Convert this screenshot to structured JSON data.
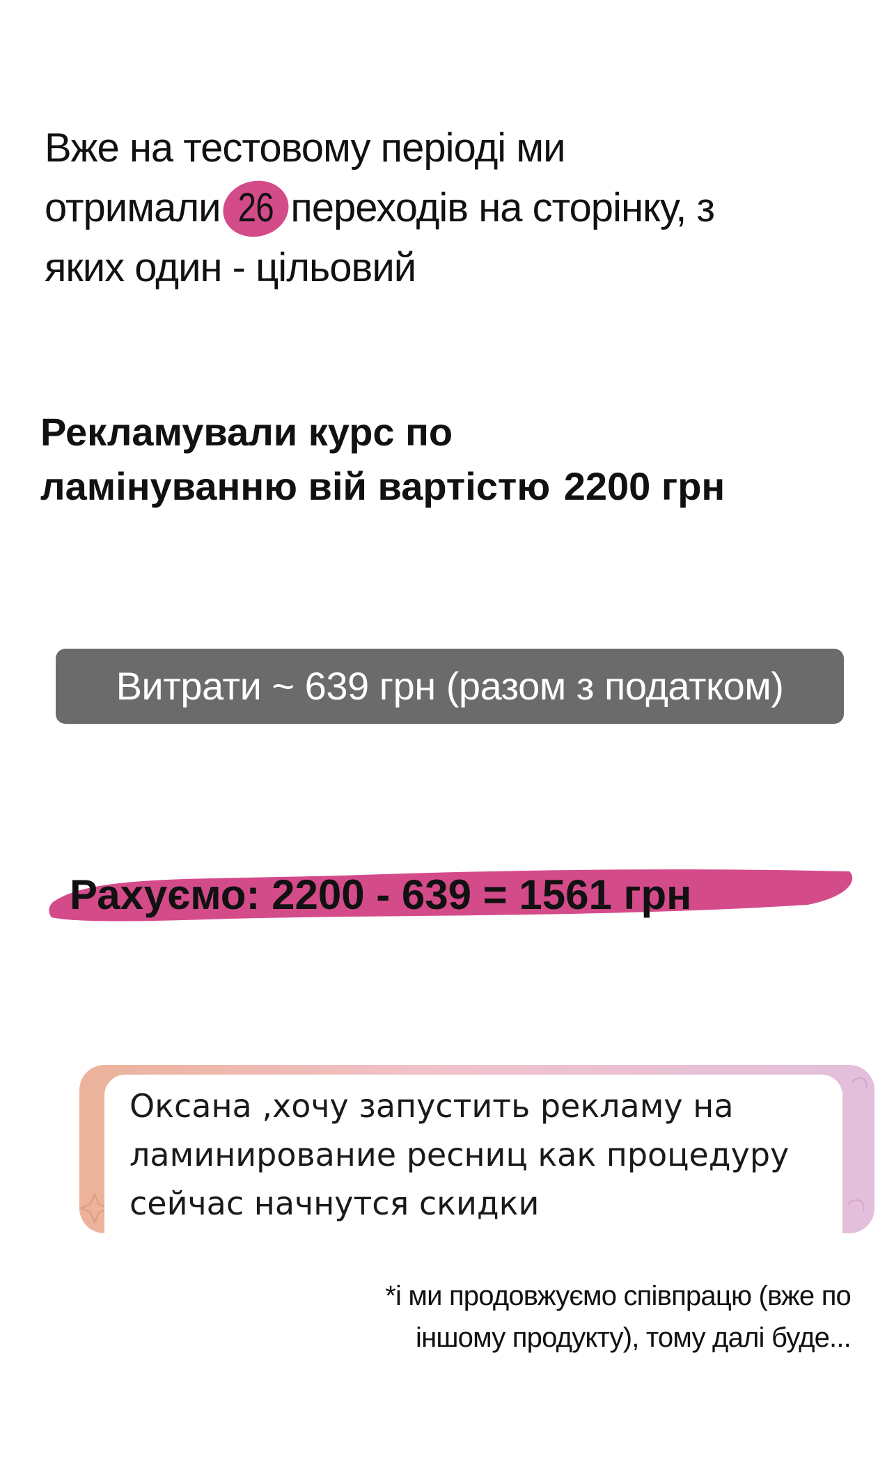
{
  "intro": {
    "line1": "Вже на тестовому періоді ми",
    "line2_before": "отримали",
    "line2_number": "26",
    "line2_after": "переходів на сторінку, з",
    "line3": "яких один - цільовий"
  },
  "course": {
    "line1": "Рекламували курс по",
    "line2_before": "ламінуванню вій вартістю",
    "price": "2200 грн"
  },
  "costs": {
    "text": "Витрати ~ 639 грн (разом з податком)"
  },
  "calc": {
    "text": "Рахуємо: 2200 - 639 = 1561 грн"
  },
  "chat": {
    "message_line1": "Оксана ,хочу запустить рекламу на",
    "message_line2": "ламинирование ресниц как процедуру",
    "message_line3": "сейчас начнутся скидки"
  },
  "note": {
    "line1": "*і ми продовжуємо співпрацю (вже по",
    "line2": "іншому продукту), тому далі буде..."
  },
  "colors": {
    "highlight": "#d44b8a",
    "pill": "#6b6b6b",
    "background": "#ffffff"
  }
}
